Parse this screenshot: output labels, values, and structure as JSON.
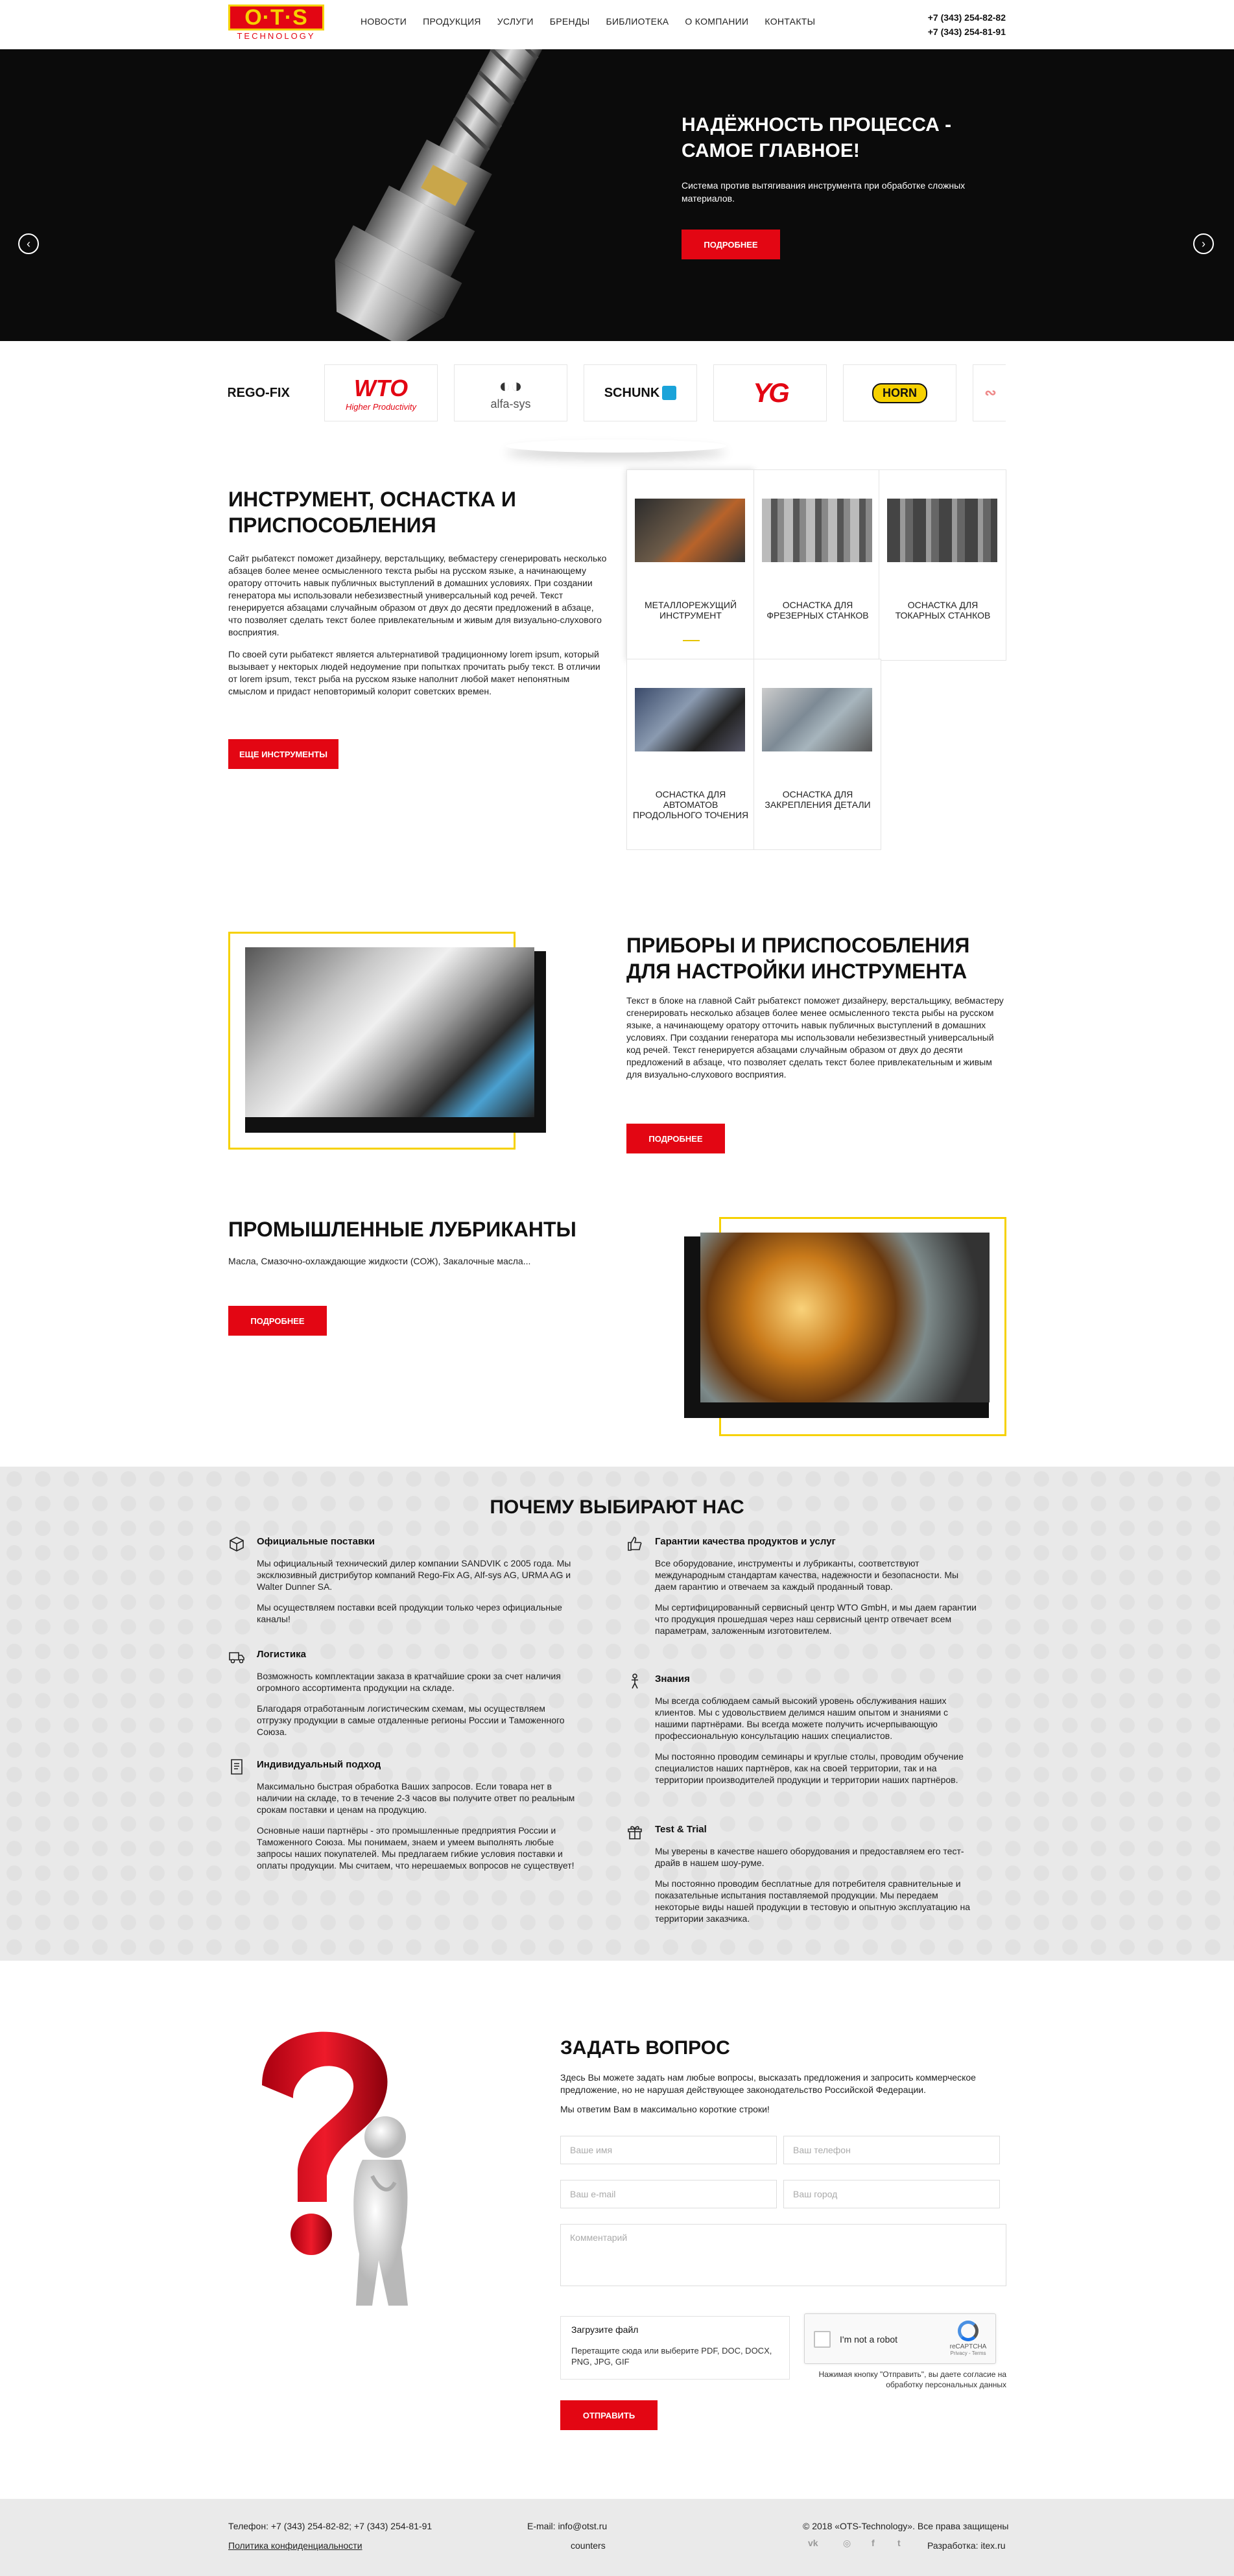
{
  "header": {
    "logo_text": "O·T·S",
    "logo_sub": "TECHNOLOGY",
    "nav": [
      "Новости",
      "Продукция",
      "Услуги",
      "Бренды",
      "Библиотека",
      "О компании",
      "Контакты"
    ],
    "phone1": "+7 (343) 254-82-82",
    "phone2": "+7 (343) 254-81-91"
  },
  "hero": {
    "title": "НАДЁЖНОСТЬ ПРОЦЕССА - САМОЕ ГЛАВНОЕ!",
    "text": "Система против вытягивания инструмента при обработке сложных материалов.",
    "button": "ПОДРОБНЕЕ",
    "prev": "‹",
    "next": "›"
  },
  "brands": [
    "REGO-FIX",
    "WTO",
    "Higher Productivity",
    "alfa-sys",
    "SCHUNK",
    "YG",
    "HORN"
  ],
  "instruments": {
    "title": "ИНСТРУМЕНТ, ОСНАСТКА И ПРИСПОСОБЛЕНИЯ",
    "p1": "Сайт рыбатекст поможет дизайнеру, верстальщику, вебмастеру сгенерировать несколько абзацев более менее осмысленного текста рыбы на русском языке, а начинающему оратору отточить навык публичных выступлений в домашних условиях. При создании генератора мы использовали небезизвестный универсальный код речей. Текст генерируется абзацами случайным образом от двух до десяти предложений в абзаце, что позволяет сделать текст более привлекательным и живым для визуально-слухового восприятия.",
    "p2": "По своей сути рыбатекст является альтернативой традиционному lorem ipsum, который вызывает у некторых людей недоумение при попытках прочитать рыбу текст. В отличии от lorem ipsum, текст рыба на русском языке наполнит любой макет непонятным смыслом и придаст неповторимый колорит советских времен.",
    "button": "ЕЩЕ ИНСТРУМЕНТЫ",
    "cards": [
      "МЕТАЛЛОРЕЖУЩИЙ ИНСТРУМЕНТ",
      "ОСНАСТКА ДЛЯ ФРЕЗЕРНЫХ СТАНКОВ",
      "ОСНАСТКА ДЛЯ ТОКАРНЫХ СТАНКОВ",
      "ОСНАСТКА ДЛЯ АВТОМАТОВ ПРОДОЛЬНОГО ТОЧЕНИЯ",
      "ОСНАСТКА ДЛЯ ЗАКРЕПЛЕНИЯ ДЕТАЛИ"
    ]
  },
  "devices": {
    "title": "ПРИБОРЫ И ПРИСПОСОБЛЕНИЯ ДЛЯ НАСТРОЙКИ ИНСТРУМЕНТА",
    "text": "Текст в блоке на главной        Сайт рыбатекст поможет дизайнеру, верстальщику, вебмастеру сгенерировать несколько абзацев более менее осмысленного текста рыбы на русском языке, а начинающему оратору отточить навык публичных выступлений в домашних условиях. При создании генератора мы использовали небезизвестный универсальный код речей. Текст генерируется абзацами случайным образом от двух до десяти предложений в абзаце, что позволяет сделать текст более привлекательным и живым для визуально-слухового восприятия.",
    "button": "ПОДРОБНЕЕ"
  },
  "lubricants": {
    "title": "ПРОМЫШЛЕННЫЕ ЛУБРИКАНТЫ",
    "text": "Масла, Смазочно-охлаждающие жидкости (СОЖ), Закалочные масла...",
    "button": "ПОДРОБНЕЕ"
  },
  "why": {
    "title": "ПОЧЕМУ ВЫБИРАЮТ НАС",
    "left": [
      {
        "title": "Официальные поставки",
        "icon": "box-icon",
        "p": [
          "Мы официальный технический дилер компании SANDVIK с 2005 года. Мы эксклюзивный дистрибутор компаний Rego-Fix AG, Alf-sys AG, URMA AG и Walter Dunner SA.",
          "Мы осуществляем поставки всей продукции только через официальные каналы!"
        ]
      },
      {
        "title": "Логистика",
        "icon": "truck-icon",
        "p": [
          "Возможность комплектации заказа в кратчайшие сроки за счет наличия огромного ассортимента продукции на складе.",
          "Благодаря отработанным логистическим схемам, мы осуществляем отгрузку продукции в самые отдаленные регионы России и Таможенного Союза."
        ]
      },
      {
        "title": "Индивидуальный подход",
        "icon": "document-icon",
        "p": [
          "Максимально быстрая обработка Ваших запросов. Если товара нет в наличии на складе, то в течение 2-3 часов вы получите ответ по реальным срокам поставки и ценам на продукцию.",
          "Основные наши партнёры - это промышленные предприятия России и Таможенного Союза. Мы понимаем, знаем и умеем выполнять любые запросы наших покупателей. Мы предлагаем гибкие условия поставки и оплаты продукции. Мы считаем, что нерешаемых вопросов не существует!"
        ]
      }
    ],
    "right": [
      {
        "title": "Гарантии качества продуктов и услуг",
        "icon": "thumbs-up-icon",
        "p": [
          "Все оборудование, инструменты и лубриканты, соответствуют международным стандартам качества, надежности и безопасности. Мы даем гарантию и отвечаем за каждый проданный товар.",
          "Мы сертифицированный сервисный центр WTO GmbH, и мы даем гарантии что продукция прошедшая через наш сервисный центр отвечает всем параметрам, заложенным изготовителем."
        ]
      },
      {
        "title": "Знания",
        "icon": "person-icon",
        "p": [
          "Мы всегда соблюдаем самый высокий уровень обслуживания наших клиентов. Мы с удовольствием делимся нашим опытом и знаниями с нашими партнёрами. Вы всегда можете получить исчерпывающую профессиональную консультацию наших специалистов.",
          "Мы постоянно проводим семинары и круглые столы, проводим обучение специалистов наших партнёров, как на своей территории, так и на территории производителей продукции и территории наших партнёров."
        ]
      },
      {
        "title": "Test & Trial",
        "icon": "gift-icon",
        "p": [
          "Мы уверены в качестве нашего оборудования и предоставляем его тест-драйв в нашем шоу-руме.",
          "Мы постоянно проводим бесплатные для потребителя сравнительные и показательные испытания поставляемой продукции. Мы передаем некоторые виды нашей продукции в тестовую и опытную эксплуатацию на территории заказчика."
        ]
      }
    ]
  },
  "ask": {
    "title": "ЗАДАТЬ ВОПРОС",
    "p1": "Здесь Вы можете задать нам любые вопросы, высказать предложения и запросить коммерческое предложение, но не нарушая действующее законодательство Российской Федерации.",
    "p2": "Мы ответим Вам в максимально короткие строки!",
    "name_ph": "Ваше имя",
    "phone_ph": "Ваш телефон",
    "email_ph": "Ваш e-mail",
    "city_ph": "Ваш город",
    "comment_ph": "Комментарий",
    "upload_title": "Загрузите файл",
    "upload_text": "Перетащите сюда или выберите PDF, DOC, DOCX, PNG, JPG, GIF",
    "captcha_label": "I'm not a robot",
    "captcha_brand": "reCAPTCHA",
    "captcha_links": "Privacy - Terms",
    "consent": "Нажимая кнопку \"Отправить\", вы даете согласие на обработку персональных данных",
    "button": "ОТПРАВИТЬ"
  },
  "footer": {
    "phones": "Телефон: +7 (343) 254-82-82; +7 (343) 254-81-91",
    "policy": "Политика конфиденциальности",
    "email": "E-mail: info@otst.ru",
    "counters": "counters",
    "copyright": "© 2018 «OTS-Technology». Все права защищены",
    "dev": "Разработка: itex.ru",
    "social": [
      "vk",
      "◎",
      "f",
      "t"
    ]
  }
}
